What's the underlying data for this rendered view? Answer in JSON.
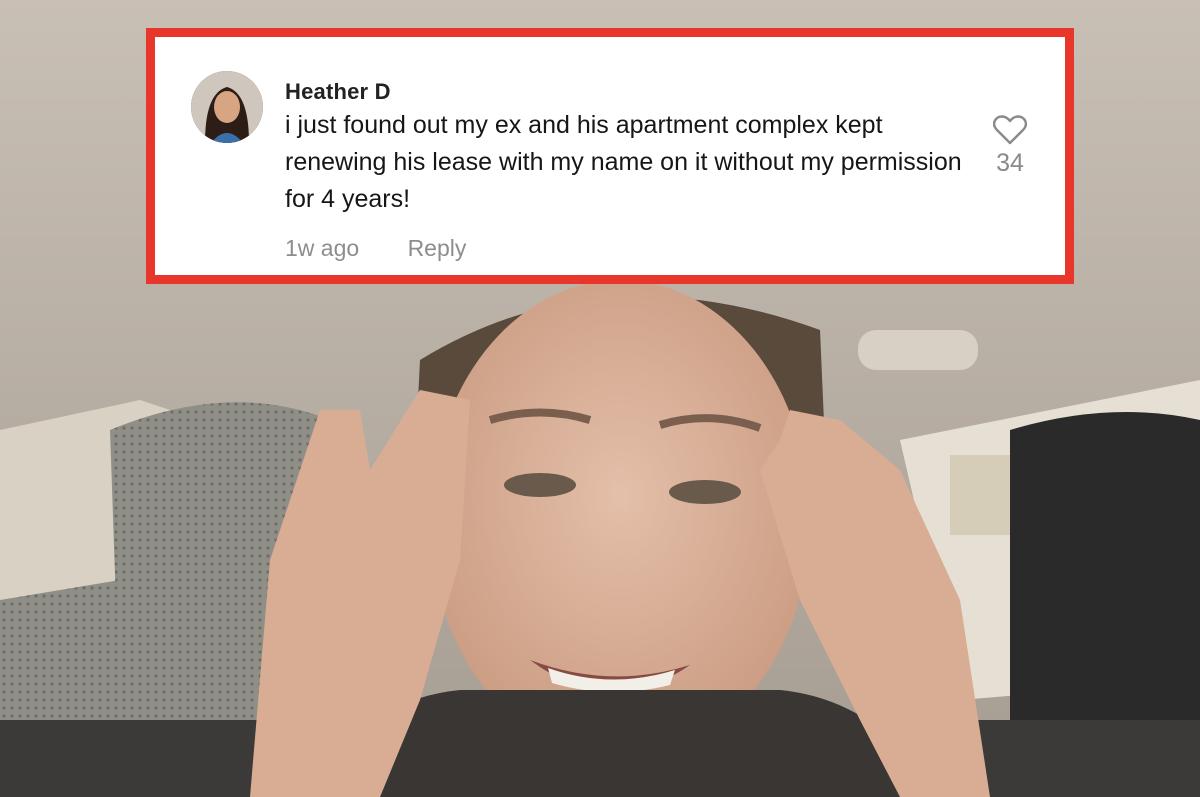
{
  "comment": {
    "username": "Heather D",
    "text": "i just found out my ex and his apartment complex kept renewing his lease with my name on it without my permission for 4 years!",
    "timestamp": "1w ago",
    "reply_label": "Reply",
    "like_count": "34",
    "like_icon": "heart-outline-icon"
  },
  "colors": {
    "frame_border": "#e8362b",
    "card_background": "#ffffff",
    "meta_text": "#8d8d8d"
  }
}
